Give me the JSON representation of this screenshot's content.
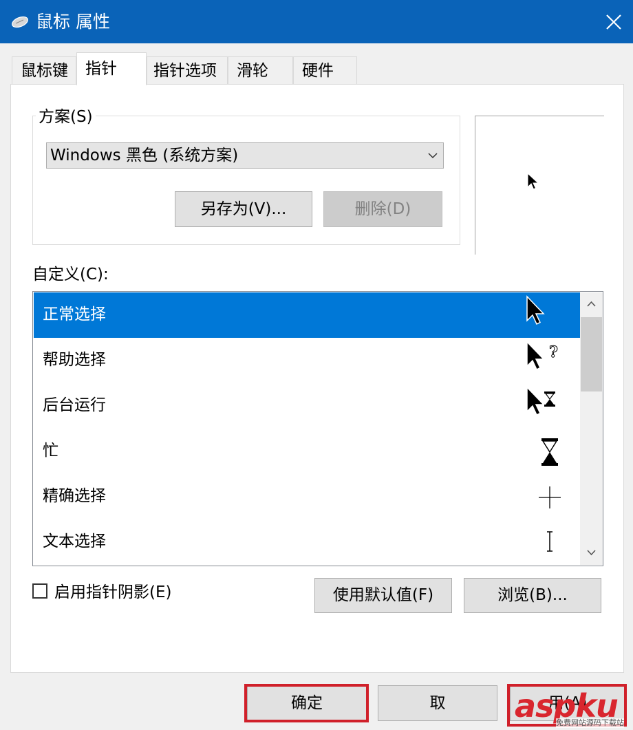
{
  "window": {
    "title": "鼠标 属性",
    "icons": {
      "app": "mouse-icon",
      "close": "close-icon"
    }
  },
  "tabs": [
    {
      "label": "鼠标键",
      "active": false
    },
    {
      "label": "指针",
      "active": true
    },
    {
      "label": "指针选项",
      "active": false
    },
    {
      "label": "滑轮",
      "active": false
    },
    {
      "label": "硬件",
      "active": false
    }
  ],
  "scheme": {
    "label": "方案(S)",
    "selected": "Windows 黑色 (系统方案)",
    "save_as_label": "另存为(V)...",
    "delete_label": "删除(D)"
  },
  "customize": {
    "label": "自定义(C):",
    "items": [
      {
        "label": "正常选择",
        "icon": "arrow-cursor-icon",
        "selected": true
      },
      {
        "label": "帮助选择",
        "icon": "help-cursor-icon",
        "selected": false
      },
      {
        "label": "后台运行",
        "icon": "working-in-background-cursor-icon",
        "selected": false
      },
      {
        "label": "忙",
        "icon": "busy-hourglass-cursor-icon",
        "selected": false
      },
      {
        "label": "精确选择",
        "icon": "crosshair-cursor-icon",
        "selected": false
      },
      {
        "label": "文本选择",
        "icon": "text-beam-cursor-icon",
        "selected": false
      }
    ]
  },
  "shadow_checkbox": {
    "label": "启用指针阴影(E)",
    "checked": false
  },
  "buttons": {
    "use_default": "使用默认值(F)",
    "browse": "浏览(B)...",
    "ok": "确定",
    "cancel": "取",
    "apply": "用(A)"
  },
  "watermark": {
    "logo": "aspku",
    "sub": "免费网站源码下载站"
  },
  "colors": {
    "titlebar": "#0a63b8",
    "selection": "#0078d7",
    "highlight_box": "#d0202a"
  }
}
